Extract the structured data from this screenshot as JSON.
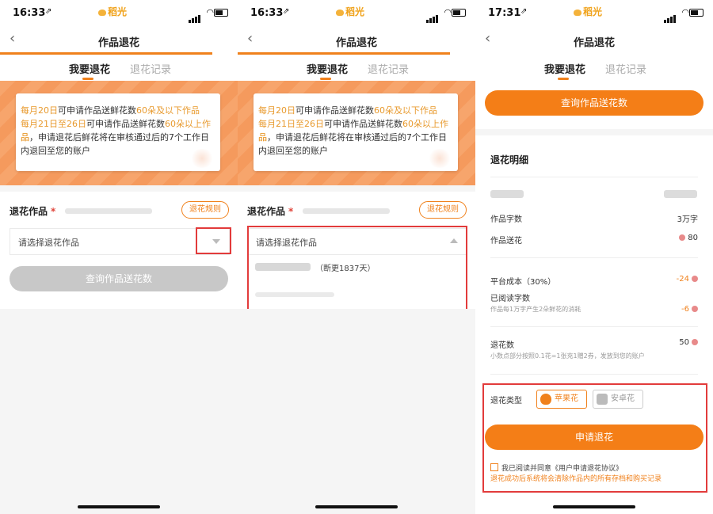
{
  "brand": "稻光",
  "page_title": "作品退花",
  "tabs": {
    "active": "我要退花",
    "inactive": "退花记录"
  },
  "notice": {
    "line1_a": "每月20日",
    "line1_b": "可申请作品送鲜花数",
    "line1_c": "60朵及以下作品",
    "line2_a": "每月21日至26日",
    "line2_b": "可申请作品送鲜花数",
    "line2_c": "60朵以上作品",
    "line3_a": "品",
    "line3_b": "，申请退花后鲜花将在审核通过后的7个工作日",
    "line4": "内退回至您的账户"
  },
  "section_label": "退花作品",
  "required_mark": "*",
  "rules_button": "退花规则",
  "select_placeholder": "请选择退花作品",
  "query_button": "查询作品送花数",
  "dropdown_option_suffix": "（断更1837天）",
  "screens": [
    {
      "time": "16:33",
      "location_glyph": "⇗"
    },
    {
      "time": "16:33",
      "location_glyph": "⇗"
    },
    {
      "time": "17:31",
      "location_glyph": "⇗"
    }
  ],
  "details": {
    "title": "退花明细",
    "word_count_label": "作品字数",
    "word_count_value": "3万字",
    "gift_label": "作品送花",
    "gift_value": "80",
    "platform_cost_label": "平台成本（30%）",
    "platform_cost_value": "-24",
    "read_words_label": "已阅读字数",
    "read_words_note": "作品每1万字产生2朵鲜花的消耗",
    "read_words_value": "-6",
    "refund_label": "退花数",
    "refund_note": "小数点部分按照0.1花=1张充1赠2券，发放到您的账户",
    "refund_value": "50"
  },
  "refund_type": {
    "label": "退花类型",
    "apple": "苹果花",
    "android": "安卓花"
  },
  "apply_button": "申请退花",
  "agreement": "我已阅读并同意《用户申请退花协议》",
  "warning": "退花成功后系统将会清除作品内的所有存档和购买记录",
  "colors": {
    "accent": "#f0811c",
    "highlight": "#e89a2e",
    "annotation_red": "#e23b3b"
  }
}
